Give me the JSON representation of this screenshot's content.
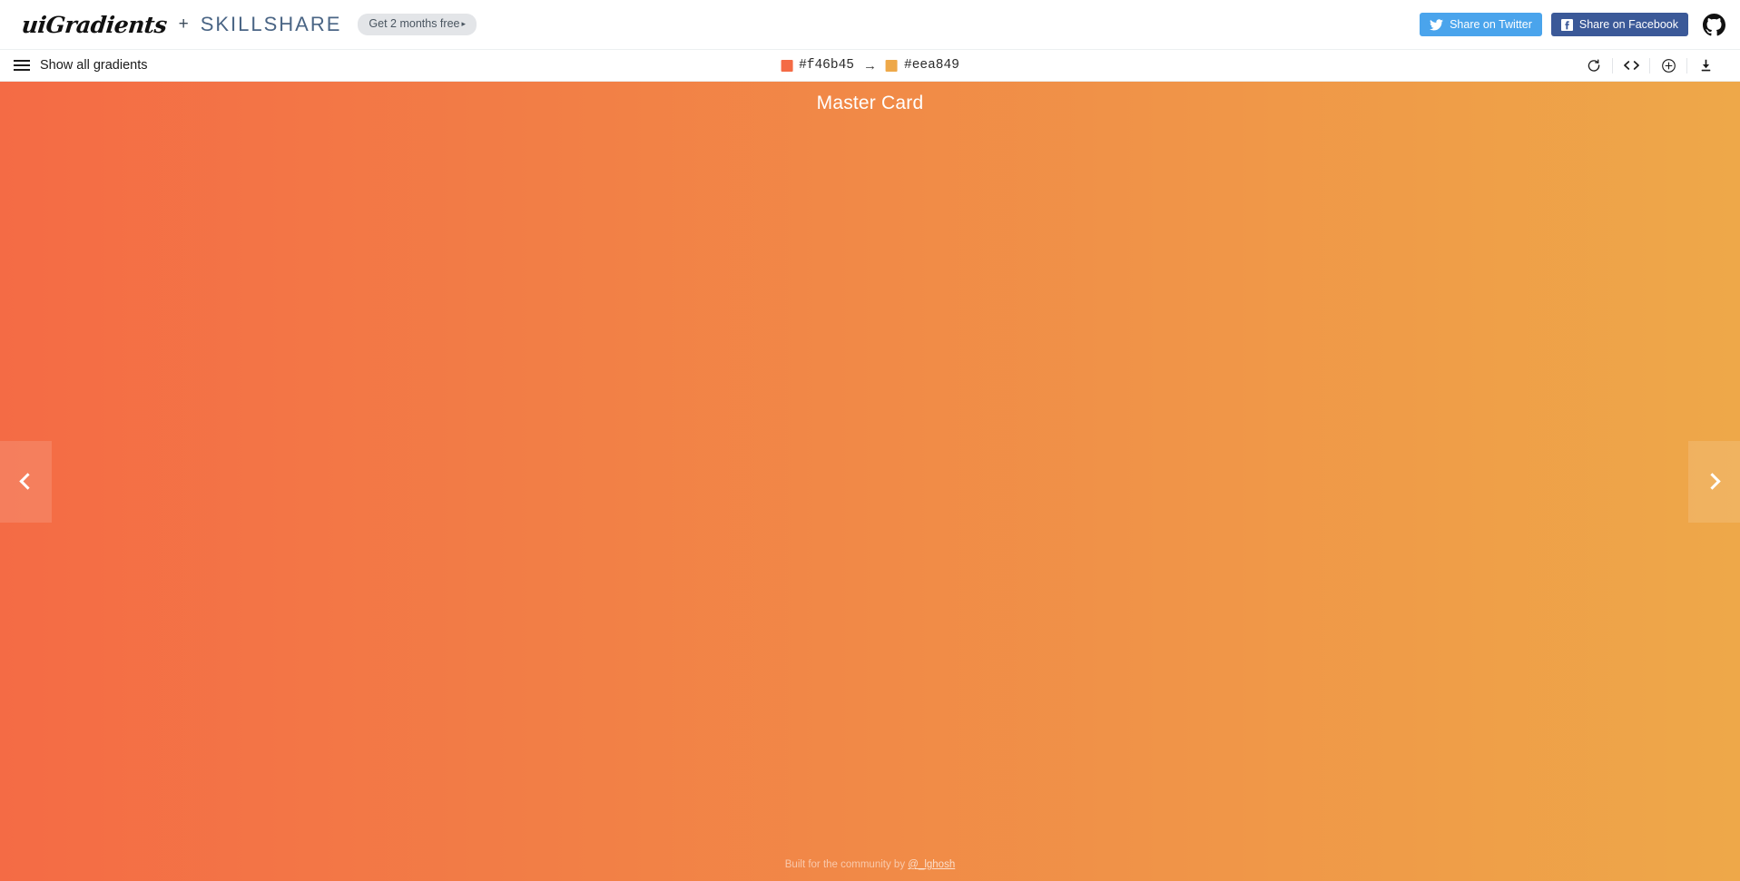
{
  "topbar": {
    "logo_text": "uiGradients",
    "plus_symbol": "+",
    "partner_text": "SKILLSHARE",
    "promo_label": "Get 2 months free",
    "promo_caret": "▸",
    "share_twitter_label": "Share on Twitter",
    "share_facebook_label": "Share on Facebook",
    "twitter_color": "#4aa4ec",
    "facebook_color": "#3b5998",
    "github_icon": "github-icon"
  },
  "subbar": {
    "show_all_label": "Show all gradients",
    "menu_icon": "hamburger-icon",
    "color_start": "#f46b45",
    "color_end": "#eea849",
    "color_start_label": "#f46b45",
    "color_end_label": "#eea849",
    "arrow": "→",
    "tools": [
      {
        "name": "rotate-icon",
        "title": "Rotate gradient"
      },
      {
        "name": "code-icon",
        "title": "Get CSS code"
      },
      {
        "name": "plus-circle-icon",
        "title": "Add gradient"
      },
      {
        "name": "download-icon",
        "title": "Download"
      }
    ]
  },
  "stage": {
    "gradient_name": "Master Card",
    "gradient_start": "#f46b45",
    "gradient_end": "#eea849",
    "prev_icon": "chevron-left-icon",
    "next_icon": "chevron-right-icon"
  },
  "footer": {
    "text_prefix": "Built for the community by ",
    "author_handle": "@_lghosh"
  }
}
